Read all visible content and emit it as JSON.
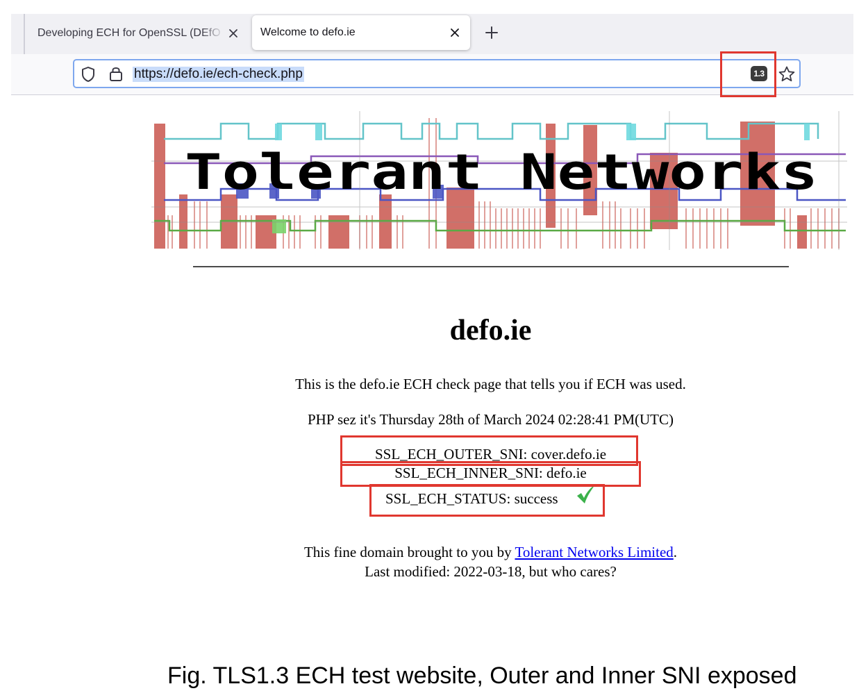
{
  "browser": {
    "tabs": [
      {
        "title": "Developing ECH for OpenSSL (DEfO",
        "active": false
      },
      {
        "title": "Welcome to defo.ie",
        "active": true
      }
    ],
    "url": "https://defo.ie/ech-check.php",
    "tls_badge": "1.3"
  },
  "page": {
    "banner_text": "Tolerant Networks",
    "heading": "defo.ie",
    "intro": "This is the defo.ie ECH check page that tells you if ECH was used.",
    "php_time": "PHP sez it's Thursday 28th of March 2024 02:28:41 PM(UTC)",
    "ssl_outer_sni": "SSL_ECH_OUTER_SNI: cover.defo.ie",
    "ssl_inner_sni": "SSL_ECH_INNER_SNI: defo.ie",
    "ssl_status": "SSL_ECH_STATUS: success",
    "footer_prefix": "This fine domain brought to you by ",
    "footer_link": "Tolerant Networks Limited",
    "footer_suffix": ".",
    "last_modified": "Last modified: 2022-03-18, but who cares?"
  },
  "caption": "Fig. TLS1.3 ECH test website, Outer and Inner SNI exposed",
  "colors": {
    "highlight_box": "#e0372f",
    "link": "#0000ee",
    "success_check": "#3bb14a",
    "url_focus": "#7ea7ee"
  }
}
